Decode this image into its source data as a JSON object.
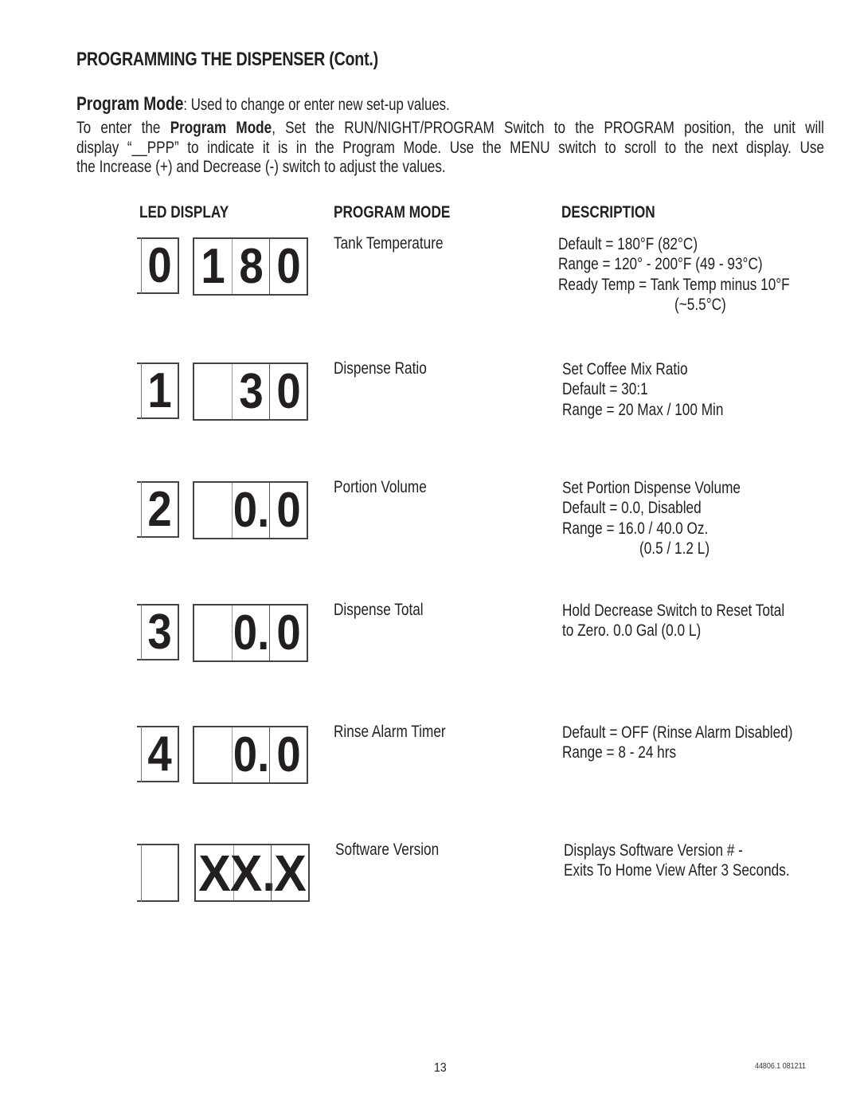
{
  "section_title": "PROGRAMMING THE DISPENSER (Cont.)",
  "program_mode_intro": {
    "label": "Program Mode",
    "text": ": Used to change or enter new set-up values."
  },
  "instructions": {
    "line1_prefix": "To enter the ",
    "line1_bold": "Program Mode",
    "line1_suffix": ", Set the RUN/NIGHT/PROGRAM Switch to the PROGRAM position, the unit will",
    "line2": "display “__PPP” to indicate it is in the Program Mode. Use the MENU switch to scroll to the next display. Use",
    "line3": "the Increase (+) and Decrease (-) switch to adjust the values."
  },
  "table": {
    "headers": {
      "led_display": "LED DISPLAY",
      "program_mode": "PROGRAM MODE",
      "description": "DESCRIPTION"
    },
    "rows": [
      {
        "index_digit": "0",
        "digits": [
          "1",
          "8",
          "0"
        ],
        "mode": "Tank Temperature",
        "description": [
          "Default = 180°F (82°C)",
          "Range = 120° - 200°F (49 - 93°C)",
          "Ready Temp = Tank Temp minus 10°F",
          "(~5.5°C)"
        ]
      },
      {
        "index_digit": "1",
        "digits": [
          "",
          "3",
          "0"
        ],
        "mode": "Dispense Ratio",
        "description": [
          "Set Coffee Mix Ratio",
          "Default = 30:1",
          "Range = 20 Max / 100 Min"
        ]
      },
      {
        "index_digit": "2",
        "digits": [
          "",
          "0.",
          "0"
        ],
        "mode": "Portion Volume",
        "description": [
          "Set Portion Dispense Volume",
          "Default = 0.0, Disabled",
          "Range = 16.0 / 40.0 Oz.",
          "(0.5 / 1.2 L)"
        ]
      },
      {
        "index_digit": "3",
        "digits": [
          "",
          "0.",
          "0"
        ],
        "mode": "Dispense Total",
        "description": [
          "Hold Decrease Switch to Reset Total",
          "to Zero. 0.0 Gal (0.0 L)"
        ]
      },
      {
        "index_digit": "4",
        "digits": [
          "",
          "0.",
          "0"
        ],
        "mode": "Rinse Alarm Timer",
        "description": [
          "Default = OFF (Rinse Alarm Disabled)",
          "Range = 8 - 24 hrs"
        ]
      },
      {
        "index_digit": "",
        "digits": [
          "X",
          "X.",
          "X"
        ],
        "mode": "Software Version",
        "description": [
          "Displays Software Version # -",
          "Exits To Home View After 3 Seconds."
        ]
      }
    ]
  },
  "footer": {
    "page_number": "13",
    "doc_code": "44806.1 081211"
  }
}
